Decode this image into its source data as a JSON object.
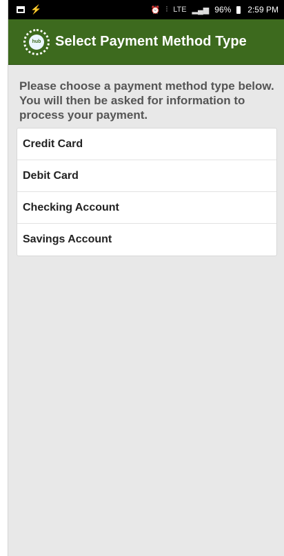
{
  "status_bar": {
    "icons_left": [
      "message-icon",
      "flash-icon"
    ],
    "lte_label": "LTE",
    "battery_percent": "96%",
    "time": "2:59 PM"
  },
  "header": {
    "logo_text": "hub",
    "title": "Select Payment Method Type",
    "background_color": "#3d6a1e"
  },
  "instructions": "Please choose a payment method type below. You will then be asked for information to process your payment.",
  "methods": [
    {
      "label": "Credit Card"
    },
    {
      "label": "Debit Card"
    },
    {
      "label": "Checking Account"
    },
    {
      "label": "Savings Account"
    }
  ]
}
